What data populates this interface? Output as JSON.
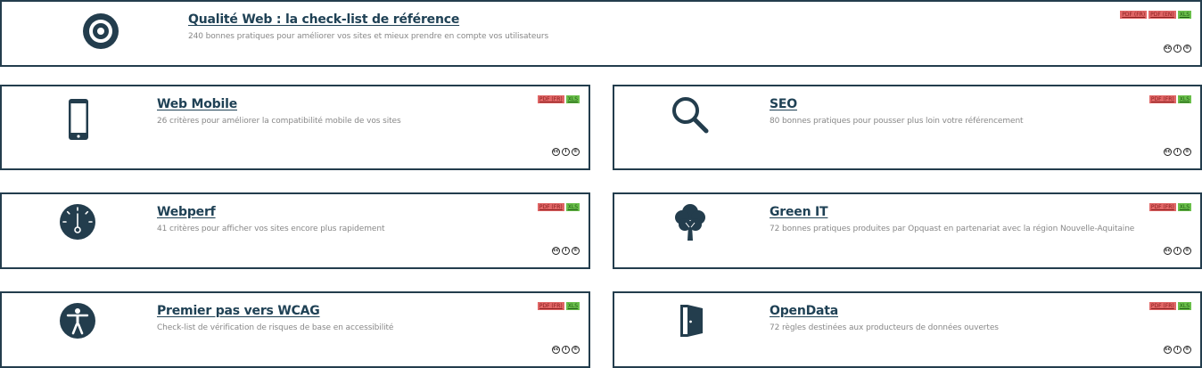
{
  "cards": [
    {
      "title": "Qualité Web : la check-list de référence",
      "desc": "240 bonnes pratiques pour améliorer vos sites et mieux prendre en compte vos utilisateurs",
      "badges": [
        "PDF (FR)",
        "PDF (EN)",
        "XLS"
      ],
      "icon": "target-icon"
    },
    {
      "title": "Web Mobile",
      "desc": "26 critères pour améliorer la compatibilité mobile de vos sites",
      "badges": [
        "PDF (FR)",
        "XLS"
      ],
      "icon": "smartphone-icon"
    },
    {
      "title": "SEO",
      "desc": "80 bonnes pratiques pour pousser plus loin votre référencement",
      "badges": [
        "PDF (FR)",
        "XLS"
      ],
      "icon": "magnifier-icon"
    },
    {
      "title": "Webperf",
      "desc": "41 critères pour afficher vos sites encore plus rapidement",
      "badges": [
        "PDF (FR)",
        "XLS"
      ],
      "icon": "speed-gauge-icon"
    },
    {
      "title": "Green IT",
      "desc": "72 bonnes pratiques produites par Opquast en partenariat avec la région Nouvelle-Aquitaine",
      "badges": [
        "PDF (FR)",
        "XLS"
      ],
      "icon": "tree-icon"
    },
    {
      "title": "Premier pas vers WCAG",
      "desc": "Check-list de vérification de risques de base en accessibilité",
      "badges": [
        "PDF (FR)",
        "XLS"
      ],
      "icon": "accessibility-icon"
    },
    {
      "title": "OpenData",
      "desc": "72 règles destinées aux producteurs de données ouvertes",
      "badges": [
        "PDF (FR)",
        "XLS"
      ],
      "icon": "open-door-icon"
    }
  ],
  "license_icons": [
    "creative-commons-icon",
    "attribution-icon",
    "share-alike-icon"
  ],
  "colors": {
    "border": "#233d4d",
    "title": "#1f4155",
    "pdf": "#e06666",
    "xls": "#6abf4b",
    "icon": "#233d4d"
  }
}
